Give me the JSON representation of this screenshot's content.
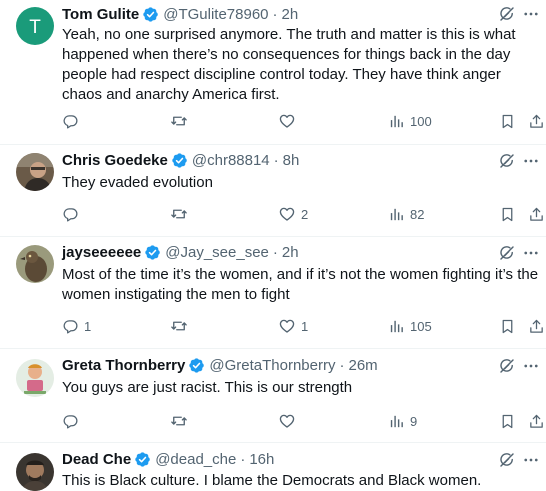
{
  "tweets": [
    {
      "name": "Tom Gulite",
      "handle": "@TGulite78960",
      "time": "2h",
      "avatar_letter": "T",
      "avatar_color": "#1a9b7a",
      "text": "Yeah, no one surprised anymore. The truth and matter is this is what happened when there’s no consequences for things back in the day people had respect discipline control today. They have think anger chaos and anarchy America first.",
      "replies": "",
      "retweets": "",
      "likes": "",
      "views": "100"
    },
    {
      "name": "Chris Goedeke",
      "handle": "@chr88814",
      "time": "8h",
      "text": "They evaded evolution",
      "replies": "",
      "retweets": "",
      "likes": "2",
      "views": "82"
    },
    {
      "name": "jayseeeeee",
      "handle": "@Jay_see_see",
      "time": "2h",
      "text": "Most of the time it’s the women, and if it’s not the women fighting it’s the women instigating the men to fight",
      "replies": "1",
      "retweets": "",
      "likes": "1",
      "views": "105"
    },
    {
      "name": "Greta Thornberry",
      "handle": "@GretaThornberry",
      "time": "26m",
      "text": "You guys are just racist. This is our strength",
      "replies": "",
      "retweets": "",
      "likes": "",
      "views": "9"
    },
    {
      "name": "Dead Che",
      "handle": "@dead_che",
      "time": "16h",
      "text": "This is Black culture. I blame the Democrats and Black women.",
      "replies": "",
      "retweets": "",
      "likes": "",
      "views": ""
    }
  ],
  "separator": "·",
  "colors": {
    "verified": "#1d9bf0",
    "secondary_text": "#536471",
    "primary_text": "#0f1419",
    "divider": "#eff3f4"
  },
  "icons": {
    "verified": "verified-badge-icon",
    "grok": "grok-icon",
    "more": "more-icon",
    "reply": "reply-icon",
    "retweet": "retweet-icon",
    "like": "heart-icon",
    "views": "views-icon",
    "bookmark": "bookmark-icon",
    "share": "share-icon"
  }
}
